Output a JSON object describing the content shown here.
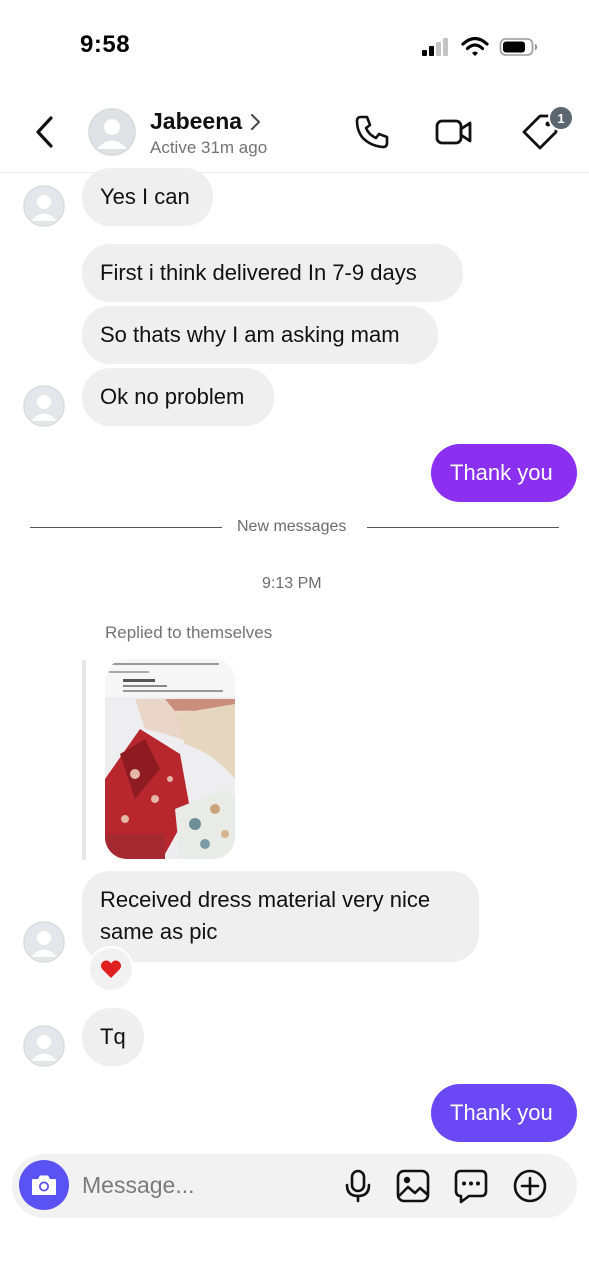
{
  "status_bar": {
    "time": "9:58"
  },
  "header": {
    "name": "Jabeena",
    "status": "Active 31m ago",
    "badge_count": "1",
    "icons": [
      "back-arrow-icon",
      "phone-icon",
      "video-camera-icon",
      "tag-icon"
    ]
  },
  "messages": [
    {
      "sender": "them",
      "text": "Yes I can"
    },
    {
      "sender": "them",
      "text": "First i think delivered In 7-9 days"
    },
    {
      "sender": "them",
      "text": "So thats why I am asking mam"
    },
    {
      "sender": "them",
      "text": "Ok no problem"
    },
    {
      "sender": "me",
      "text": "Thank you"
    }
  ],
  "divider": {
    "label": "New messages"
  },
  "timestamp": "9:13 PM",
  "reply": {
    "label": "Replied to themselves"
  },
  "messages2": [
    {
      "sender": "them",
      "text_line1": "Received dress material very nice",
      "text_line2": "same as pic",
      "reaction": "heart"
    },
    {
      "sender": "them",
      "text": "Tq"
    },
    {
      "sender": "me",
      "text": "Thank you"
    }
  ],
  "composer": {
    "placeholder": "Message...",
    "icons": [
      "camera-icon",
      "microphone-icon",
      "gallery-icon",
      "sticker-icon",
      "add-icon"
    ]
  },
  "colors": {
    "outgoing_bubble_1": "#8b2ff0",
    "outgoing_bubble_2": "#6a48f5",
    "camera_button": "#5b52f4",
    "incoming_bubble": "#efeff0"
  }
}
